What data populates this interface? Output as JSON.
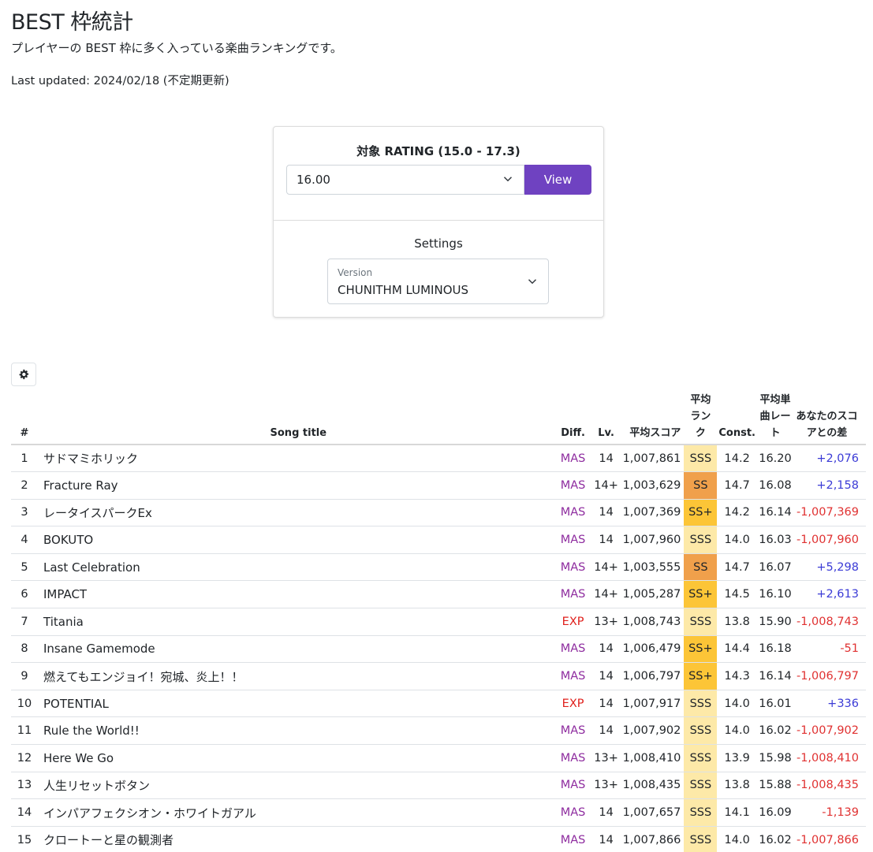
{
  "header": {
    "title": "BEST 枠統計",
    "description": "プレイヤーの BEST 枠に多く入っている楽曲ランキングです。",
    "last_updated": "Last updated: 2024/02/18 (不定期更新)"
  },
  "rating_card": {
    "title": "対象 RATING (15.0 - 17.3)",
    "selected_rating": "16.00",
    "view_label": "View",
    "settings_title": "Settings",
    "version_label": "Version",
    "version_value": "CHUNITHM LUMINOUS"
  },
  "icons": {
    "settings": "gear-icon",
    "dropdown": "chevron-down-icon"
  },
  "colors": {
    "accent": "#6f42c1",
    "mas": "#8e2c9f",
    "exp": "#e0201c",
    "rank_sss": "#fde9a8",
    "rank_ss_plus": "#fcc537",
    "rank_ss": "#f0a04b",
    "positive": "#3b3bd6",
    "negative": "#e03131"
  },
  "table": {
    "headers": {
      "no": "#",
      "title": "Song title",
      "diff": "Diff.",
      "lv": "Lv.",
      "avg_score": "平均スコア",
      "avg_rank": "平均ランク",
      "const": "Const.",
      "avg_rate": "平均単曲レート",
      "your_diff": "あなたのスコアとの差"
    },
    "rows": [
      {
        "no": "1",
        "title": "サドマミホリック",
        "diff": "MAS",
        "lv": "14",
        "score": "1,007,861",
        "rank": "SSS",
        "const": "14.2",
        "rate": "16.20",
        "delta": "+2,076"
      },
      {
        "no": "2",
        "title": "Fracture Ray",
        "diff": "MAS",
        "lv": "14+",
        "score": "1,003,629",
        "rank": "SS",
        "const": "14.7",
        "rate": "16.08",
        "delta": "+2,158"
      },
      {
        "no": "3",
        "title": "レータイスパークEx",
        "diff": "MAS",
        "lv": "14",
        "score": "1,007,369",
        "rank": "SS+",
        "const": "14.2",
        "rate": "16.14",
        "delta": "-1,007,369"
      },
      {
        "no": "4",
        "title": "BOKUTO",
        "diff": "MAS",
        "lv": "14",
        "score": "1,007,960",
        "rank": "SSS",
        "const": "14.0",
        "rate": "16.03",
        "delta": "-1,007,960"
      },
      {
        "no": "5",
        "title": "Last Celebration",
        "diff": "MAS",
        "lv": "14+",
        "score": "1,003,555",
        "rank": "SS",
        "const": "14.7",
        "rate": "16.07",
        "delta": "+5,298"
      },
      {
        "no": "6",
        "title": "IMPACT",
        "diff": "MAS",
        "lv": "14+",
        "score": "1,005,287",
        "rank": "SS+",
        "const": "14.5",
        "rate": "16.10",
        "delta": "+2,613"
      },
      {
        "no": "7",
        "title": "Titania",
        "diff": "EXP",
        "lv": "13+",
        "score": "1,008,743",
        "rank": "SSS",
        "const": "13.8",
        "rate": "15.90",
        "delta": "-1,008,743"
      },
      {
        "no": "8",
        "title": "Insane Gamemode",
        "diff": "MAS",
        "lv": "14",
        "score": "1,006,479",
        "rank": "SS+",
        "const": "14.4",
        "rate": "16.18",
        "delta": "-51"
      },
      {
        "no": "9",
        "title": "燃えてもエンジョイ！宛城、炎上！！",
        "diff": "MAS",
        "lv": "14",
        "score": "1,006,797",
        "rank": "SS+",
        "const": "14.3",
        "rate": "16.14",
        "delta": "-1,006,797"
      },
      {
        "no": "10",
        "title": "POTENTIAL",
        "diff": "EXP",
        "lv": "14",
        "score": "1,007,917",
        "rank": "SSS",
        "const": "14.0",
        "rate": "16.01",
        "delta": "+336"
      },
      {
        "no": "11",
        "title": "Rule the World!!",
        "diff": "MAS",
        "lv": "14",
        "score": "1,007,902",
        "rank": "SSS",
        "const": "14.0",
        "rate": "16.02",
        "delta": "-1,007,902"
      },
      {
        "no": "12",
        "title": "Here We Go",
        "diff": "MAS",
        "lv": "13+",
        "score": "1,008,410",
        "rank": "SSS",
        "const": "13.9",
        "rate": "15.98",
        "delta": "-1,008,410"
      },
      {
        "no": "13",
        "title": "人生リセットボタン",
        "diff": "MAS",
        "lv": "13+",
        "score": "1,008,435",
        "rank": "SSS",
        "const": "13.8",
        "rate": "15.88",
        "delta": "-1,008,435"
      },
      {
        "no": "14",
        "title": "インパアフェクシオン・ホワイトガアル",
        "diff": "MAS",
        "lv": "14",
        "score": "1,007,657",
        "rank": "SSS",
        "const": "14.1",
        "rate": "16.09",
        "delta": "-1,139"
      },
      {
        "no": "15",
        "title": "クロートーと星の観測者",
        "diff": "MAS",
        "lv": "14",
        "score": "1,007,866",
        "rank": "SSS",
        "const": "14.0",
        "rate": "16.02",
        "delta": "-1,007,866"
      }
    ]
  }
}
